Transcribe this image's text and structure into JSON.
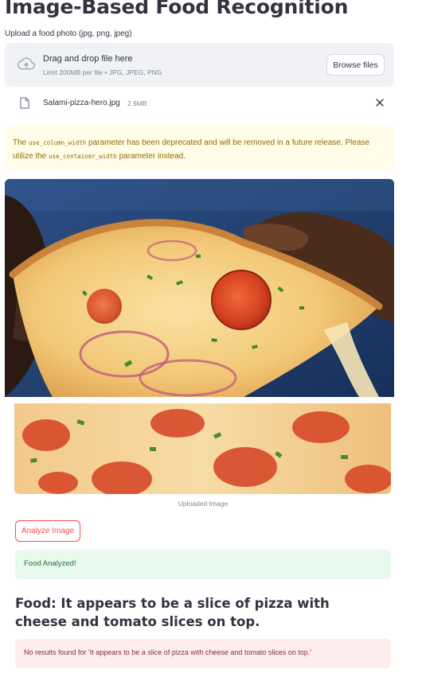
{
  "page": {
    "title": "Image-Based Food Recognition"
  },
  "uploader": {
    "label": "Upload a food photo (jpg, png, jpeg)",
    "drop_title": "Drag and drop file here",
    "limit_text": "Limit 200MB per file • JPG, JPEG, PNG",
    "browse_label": "Browse files",
    "icon": "cloud-upload-icon"
  },
  "uploaded_file": {
    "name": "Salami-pizza-hero.jpg",
    "size": "2.6MB",
    "icon": "file-icon",
    "remove_icon": "close-icon"
  },
  "warning": {
    "part1": "The ",
    "code1": "use_column_width",
    "part2": " parameter has been deprecated and will be removed in a future release. Please utilize the ",
    "code2": "use_container_width",
    "part3": " parameter instead."
  },
  "image": {
    "caption": "Uploaded Image"
  },
  "actions": {
    "analyze_label": "Analyze Image"
  },
  "status": {
    "success_text": "Food Analyzed!"
  },
  "result": {
    "food_heading": "Food: It appears to be a slice of pizza with cheese and tomato slices on top.",
    "error_text": "No results found for 'It appears to be a slice of pizza with cheese and tomato slices on top.'"
  },
  "colors": {
    "accent": "#ff4b4b",
    "success_bg": "#e8f9ee",
    "warning_bg": "#fffce7",
    "error_bg": "#ffecec"
  }
}
